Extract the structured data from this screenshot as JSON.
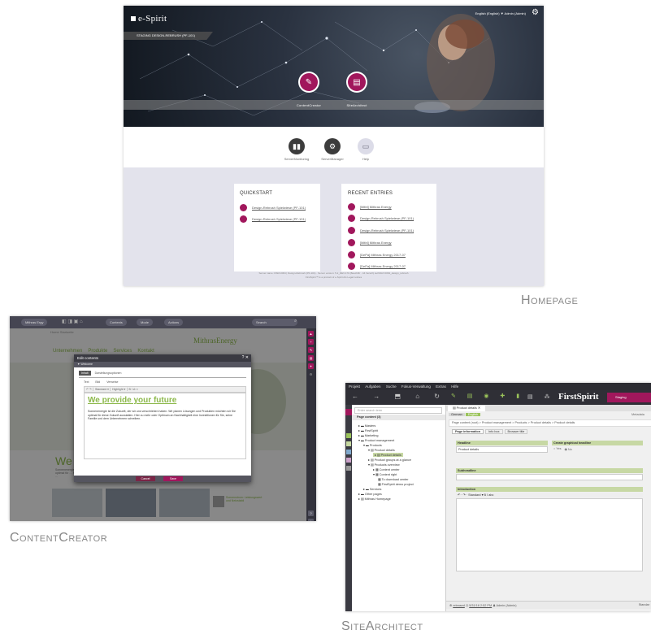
{
  "captions": {
    "homepage": "Homepage",
    "contentcreator": "ContentCreator",
    "sitearchitect": "SiteArchitect"
  },
  "homepage": {
    "logo": "e-Spirit",
    "user_bar": "English (English) ▼   Admin (Admin)",
    "stage": "STAGING DESIGN-REBRUSH (PF-101)",
    "apps": [
      {
        "label": "ContentCreator",
        "icon": "pencil-icon"
      },
      {
        "label": "SiteArchitect",
        "icon": "document-icon"
      }
    ],
    "tools": [
      {
        "label": "ServerMonitoring",
        "icon": "bar-chart-icon"
      },
      {
        "label": "ServerManager",
        "icon": "gear-icon"
      },
      {
        "label": "Help",
        "icon": "book-icon"
      }
    ],
    "quickstart": {
      "title": "QUICKSTART",
      "items": [
        "Design-Rebrush Spielwiese (PF-101)",
        "Design-Rebrush Spielwiese (PF-101)"
      ]
    },
    "recent": {
      "title": "RECENT ENTRIES",
      "items": [
        "[Mithl] Mithras Energy",
        "Design-Rebrush Spielwiese (PF-101)",
        "Design-Rebrush Spielwiese (PF-101)",
        "[Mithl] Mithras Energy",
        "[DePa] Mithras Energy 2017-07",
        "[DePa] Mithras Energy 2017-07"
      ]
    },
    "footer1": "Server name: DSM-0064 | Design-Rebrush (PF-101) · Server version: 5.2_DEV.170 (Beschiftr · 44 Versch) techDAY-0064_design_rebrush",
    "footer2": "FirstSpirit™ is a product of e-Spirit AG  Legal notices"
  },
  "contentcreator": {
    "toolbar": [
      "Mithras Ergy",
      "Contexts",
      "Mode",
      "Actions"
    ],
    "search": "Search",
    "brand": "MithrasEnergy",
    "breadcrumb": "Home   Startseite",
    "nav": [
      "Unternehmen",
      "Produkte",
      "Services",
      "Kontakt"
    ],
    "dialog_title": "Edit contents",
    "dialog_sub": "▼ Welcome",
    "tabs": [
      "Inhalt",
      "Darstellungsoptionen"
    ],
    "subtabs": [
      "Text",
      "Bild",
      "Verweise"
    ],
    "headline": "We provide your future",
    "body": "Sonnenenergie ist die Zukunft, der wir uns verschrieben haben. Wir planen Lösungen und Produkten möchten wir Sie optimal für diese Zukunft ausstatten. Hier zu mehr oder Optimum an Nachhaltigkeit eine Investitionen für Sie, seine Familie und dem Unternehmen schreiben.",
    "cancel": "Cancel",
    "save": "Save",
    "page_title": "We",
    "page_text": "Sonnenenergie … optimal für … Familie und …",
    "news": "Sonnenstrom: Leistungswert und Netzstabil"
  },
  "sitearchitect": {
    "menu": [
      "Projekt",
      "Aufgaben",
      "Suche",
      "Fokus-Verwaltung",
      "Extras",
      "Hilfe"
    ],
    "brand": "FirstSpirit",
    "staging_badge": "Staging",
    "search_placeholder": "Enter search term",
    "tree_root": "Page content (3)",
    "tree": [
      "Masters",
      "FirstSpirit",
      "Marketing",
      "Product management",
      "Products",
      "Product details",
      "Product details",
      "Product groups at a glance",
      "Products overview",
      "Content center",
      "Content right",
      "To download center",
      "FirstSpirit demo project",
      "Services",
      "Other pages",
      "Mithras Homepage"
    ],
    "doc_tab": "Product details",
    "lang_tabs": [
      "German",
      "English"
    ],
    "metadata": "Metadata",
    "breadcrumb": "Page content (root) > Product management > Products > Product details > Product details",
    "form_tabs": [
      "Page information",
      "Info box",
      "Browser title"
    ],
    "headline_label": "Headline",
    "headline_value": "Product details",
    "graphical_label": "Create graphical headline",
    "radio_yes": "Yes",
    "radio_no": "No",
    "subheadline_label": "Subheadline",
    "introduction_label": "Introduction",
    "editor_toolbar": "↶ · ↷ · Standard ▾  B  I  abc",
    "status_user": "released",
    "status_time": "5/31/16 2:52 PM",
    "status_admin": "Admin (Admin)",
    "status_right": "Standar"
  }
}
